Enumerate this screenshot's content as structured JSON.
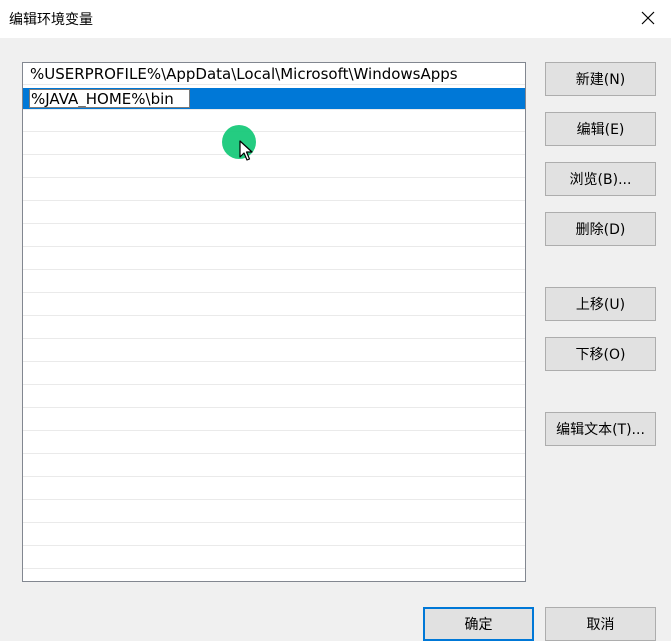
{
  "window": {
    "title": "编辑环境变量",
    "close_icon": "close-icon"
  },
  "path_list": {
    "entries": [
      "%USERPROFILE%\\AppData\\Local\\Microsoft\\WindowsApps",
      "%JAVA_HOME%\\bin"
    ],
    "selected_index": 1,
    "editing_value": "%JAVA_HOME%\\bin",
    "selection_color": "#0078d7"
  },
  "buttons": {
    "new": "新建(N)",
    "edit": "编辑(E)",
    "browse": "浏览(B)...",
    "delete": "删除(D)",
    "move_up": "上移(U)",
    "move_down": "下移(O)",
    "edit_text": "编辑文本(T)...",
    "ok": "确定",
    "cancel": "取消"
  },
  "colors": {
    "accent": "#0078d7",
    "cursor_highlight": "#18c97a"
  }
}
